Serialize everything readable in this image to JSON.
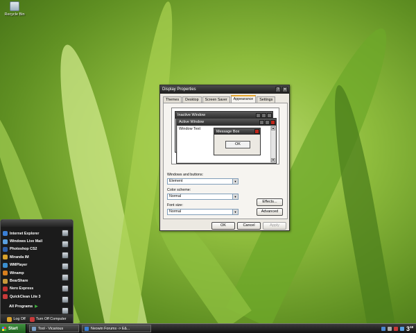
{
  "desktop": {
    "icons": [
      {
        "label": "Recycle Bin",
        "icon": "recycle-bin-icon"
      }
    ]
  },
  "dialog": {
    "title": "Display Properties",
    "tabs": [
      "Themes",
      "Desktop",
      "Screen Saver",
      "Appearance",
      "Settings"
    ],
    "active_tab": "Appearance",
    "preview": {
      "inactive_window_title": "Inactive Window",
      "active_window_title": "Active Window",
      "window_text": "Window Text",
      "message_box_title": "Message Box",
      "message_box_ok": "OK"
    },
    "windows_buttons_label": "Windows and buttons:",
    "windows_buttons_value": "Element",
    "color_scheme_label": "Color scheme:",
    "color_scheme_value": "Normal",
    "font_size_label": "Font size:",
    "font_size_value": "Normal",
    "effects_button": "Effects...",
    "advanced_button": "Advanced",
    "ok_button": "OK",
    "cancel_button": "Cancel",
    "apply_button": "Apply"
  },
  "start_menu": {
    "items": [
      {
        "label": "Internet Explorer",
        "icon": "internet-explorer-icon",
        "color": "#3a7fd5"
      },
      {
        "label": "Windows Live Mail",
        "icon": "mail-icon",
        "color": "#5aa0e0"
      },
      {
        "label": "Photoshop CS2",
        "icon": "photoshop-icon",
        "color": "#2c5ea8"
      },
      {
        "label": "Miranda IM",
        "icon": "miranda-icon",
        "color": "#d9a22b"
      },
      {
        "label": "WMPlayer",
        "icon": "media-player-icon",
        "color": "#3b8fd0"
      },
      {
        "label": "Winamp",
        "icon": "winamp-icon",
        "color": "#d87f1e"
      },
      {
        "label": "BearShare",
        "icon": "bearshare-icon",
        "color": "#c89a3a"
      },
      {
        "label": "Nero Express",
        "icon": "nero-icon",
        "color": "#c03030"
      },
      {
        "label": "QuickClean Lite 3",
        "icon": "quickclean-icon",
        "color": "#c83a3a"
      }
    ],
    "all_programs": "All Programs",
    "log_off": "Log Off",
    "turn_off": "Turn Off Computer"
  },
  "taskbar": {
    "start_label": "Start",
    "tasks": [
      {
        "label": "Tool - Vicarious",
        "icon": "tool-icon",
        "color": "#7aa0c8"
      },
      {
        "label": "Neowin Forums -> E&...",
        "icon": "browser-icon",
        "color": "#3a7fd5"
      }
    ],
    "clock_hour": "3",
    "clock_minute": "18"
  }
}
